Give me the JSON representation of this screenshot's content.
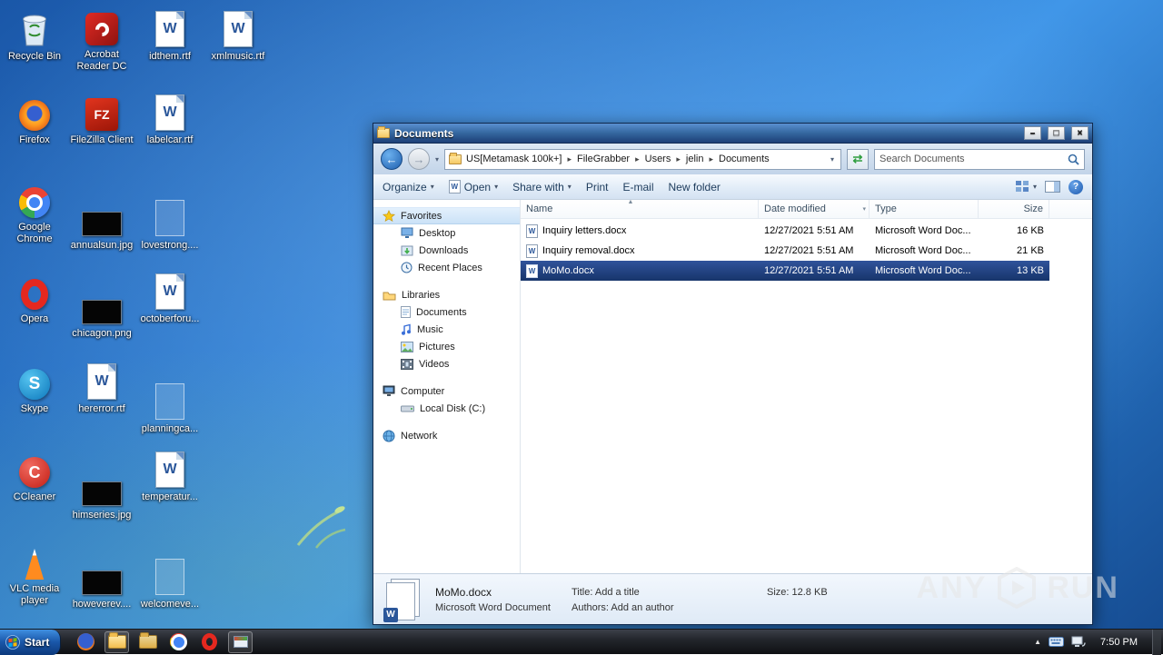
{
  "desktop": {
    "icons": [
      {
        "label": "Recycle Bin",
        "icon": "recycle-bin"
      },
      {
        "label": "Firefox",
        "icon": "firefox"
      },
      {
        "label": "Google Chrome",
        "icon": "chrome"
      },
      {
        "label": "Opera",
        "icon": "opera"
      },
      {
        "label": "Skype",
        "icon": "skype"
      },
      {
        "label": "CCleaner",
        "icon": "ccleaner"
      },
      {
        "label": "VLC media player",
        "icon": "vlc"
      },
      {
        "label": "Acrobat Reader DC",
        "icon": "acrobat"
      },
      {
        "label": "FileZilla Client",
        "icon": "filezilla"
      },
      {
        "label": "annualsun.jpg",
        "icon": "image-thumbnail"
      },
      {
        "label": "chicagon.png",
        "icon": "image-thumbnail"
      },
      {
        "label": "hererror.rtf",
        "icon": "word-document"
      },
      {
        "label": "himseries.jpg",
        "icon": "image-thumbnail"
      },
      {
        "label": "howeverev....",
        "icon": "image-thumbnail"
      },
      {
        "label": "idthem.rtf",
        "icon": "word-document"
      },
      {
        "label": "labelcar.rtf",
        "icon": "word-document"
      },
      {
        "label": "lovestrong....",
        "icon": "ghost-placeholder"
      },
      {
        "label": "octoberforu...",
        "icon": "word-document"
      },
      {
        "label": "planningca...",
        "icon": "ghost-placeholder"
      },
      {
        "label": "temperatur...",
        "icon": "word-document"
      },
      {
        "label": "welcomeve...",
        "icon": "ghost-placeholder"
      },
      {
        "label": "xmlmusic.rtf",
        "icon": "word-document"
      }
    ]
  },
  "window": {
    "title": "Documents",
    "breadcrumb": {
      "items": [
        "US[Metamask 100k+]",
        "FileGrabber",
        "Users",
        "jelin",
        "Documents"
      ]
    },
    "search": {
      "placeholder": "Search Documents"
    },
    "toolbar": {
      "organize": "Organize",
      "open": "Open",
      "share": "Share with",
      "print": "Print",
      "email": "E-mail",
      "new_folder": "New folder"
    },
    "sidebar": {
      "favorites": {
        "label": "Favorites",
        "items": [
          "Desktop",
          "Downloads",
          "Recent Places"
        ]
      },
      "libraries": {
        "label": "Libraries",
        "items": [
          "Documents",
          "Music",
          "Pictures",
          "Videos"
        ]
      },
      "computer": {
        "label": "Computer",
        "items": [
          "Local Disk (C:)"
        ]
      },
      "network": {
        "label": "Network"
      }
    },
    "list": {
      "columns": [
        "Name",
        "Date modified",
        "Type",
        "Size"
      ],
      "rows": [
        {
          "name": "Inquiry letters.docx",
          "date": "12/27/2021 5:51 AM",
          "type": "Microsoft Word Doc...",
          "size": "16 KB",
          "selected": false
        },
        {
          "name": "Inquiry removal.docx",
          "date": "12/27/2021 5:51 AM",
          "type": "Microsoft Word Doc...",
          "size": "21 KB",
          "selected": false
        },
        {
          "name": "MoMo.docx",
          "date": "12/27/2021 5:51 AM",
          "type": "Microsoft Word Doc...",
          "size": "13 KB",
          "selected": true
        }
      ]
    },
    "details": {
      "file_name": "MoMo.docx",
      "file_type": "Microsoft Word Document",
      "title": "Title: Add a title",
      "authors": "Authors: Add an author",
      "size": "Size: 12.8 KB"
    }
  },
  "taskbar": {
    "start_label": "Start",
    "clock": "7:50 PM"
  },
  "watermark": {
    "left": "ANY",
    "right": "RUN"
  }
}
